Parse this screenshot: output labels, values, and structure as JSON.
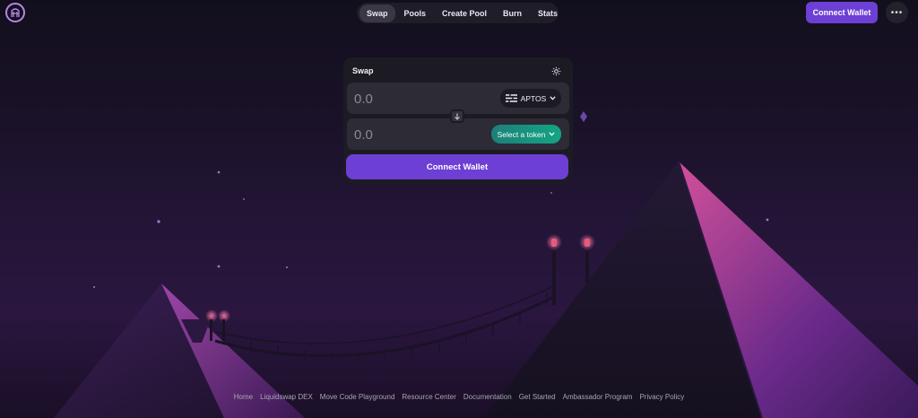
{
  "header": {
    "logo_icon": "liquidswap-logo-icon",
    "nav_tabs": [
      {
        "label": "Swap",
        "active": true
      },
      {
        "label": "Pools",
        "active": false
      },
      {
        "label": "Create Pool",
        "active": false
      },
      {
        "label": "Burn",
        "active": false
      },
      {
        "label": "Stats",
        "active": false
      }
    ],
    "connect_wallet_label": "Connect Wallet",
    "more_icon": "more-horizontal-icon"
  },
  "swap_card": {
    "title": "Swap",
    "settings_icon": "gear-icon",
    "from": {
      "amount_placeholder": "0.0",
      "amount_value": "",
      "token_label": "APTOS",
      "token_icon": "aptos-icon"
    },
    "switch_icon": "arrow-down-icon",
    "to": {
      "amount_placeholder": "0.0",
      "amount_value": "",
      "token_label": "Select a token"
    },
    "connect_button_label": "Connect Wallet"
  },
  "footer_links": [
    "Home",
    "Liquidswap DEX",
    "Move Code Playground",
    "Resource Center",
    "Documentation",
    "Get Started",
    "Ambassador Program",
    "Privacy Policy"
  ],
  "colors": {
    "accent": "#6d3fd4",
    "select_token_gradient_start": "#1d7f7a",
    "select_token_gradient_end": "#13a584",
    "card_bg": "#1c1b23",
    "field_bg": "#2d2b36"
  }
}
